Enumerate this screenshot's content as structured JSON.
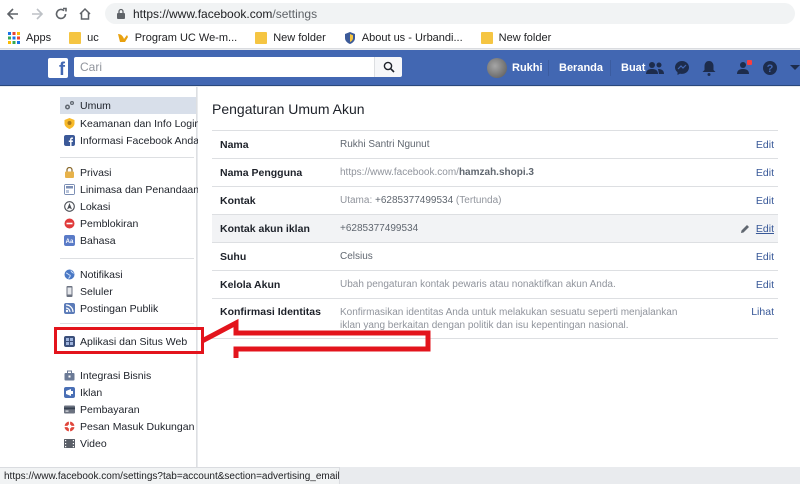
{
  "browser": {
    "url_host": "https://www.facebook.com",
    "url_path": "/settings",
    "bookmarks": [
      {
        "label": "Apps",
        "icon": "apps-grid-icon"
      },
      {
        "label": "uc",
        "icon": "folder-icon"
      },
      {
        "label": "Program UC We-m...",
        "icon": "uc-icon"
      },
      {
        "label": "New folder",
        "icon": "folder-icon"
      },
      {
        "label": "About us - Urbandi...",
        "icon": "shield-icon"
      },
      {
        "label": "New folder",
        "icon": "folder-icon"
      }
    ],
    "status_url": "https://www.facebook.com/settings?tab=account&section=advertising_email"
  },
  "fb": {
    "search_placeholder": "Cari",
    "user_name": "Rukhi",
    "nav_home": "Beranda",
    "nav_create": "Buat",
    "brand_color": "#4267b2"
  },
  "sidebar": {
    "group1": [
      {
        "label": "Umum",
        "icon": "gear-icon",
        "color": "#8d949e",
        "active": true
      },
      {
        "label": "Keamanan dan Info Login",
        "icon": "badge-icon",
        "color": "#f7b928"
      },
      {
        "label": "Informasi Facebook Anda",
        "icon": "facebook-icon",
        "color": "#3b5998"
      }
    ],
    "group2": [
      {
        "label": "Privasi",
        "icon": "lock-icon",
        "color": "#e7b24a"
      },
      {
        "label": "Linimasa dan Penandaan",
        "icon": "timeline-icon",
        "color": "#7c8fb5"
      },
      {
        "label": "Lokasi",
        "icon": "location-icon",
        "color": "#4b4f56"
      },
      {
        "label": "Pemblokiran",
        "icon": "block-icon",
        "color": "#e03b3b"
      },
      {
        "label": "Bahasa",
        "icon": "language-icon",
        "color": "#5a7bc7"
      }
    ],
    "group3": [
      {
        "label": "Notifikasi",
        "icon": "globe-icon",
        "color": "#4a78c4"
      },
      {
        "label": "Seluler",
        "icon": "mobile-icon",
        "color": "#6b7280"
      },
      {
        "label": "Postingan Publik",
        "icon": "rss-icon",
        "color": "#5b7bb8"
      }
    ],
    "group4": [
      {
        "label": "Aplikasi dan Situs Web",
        "icon": "apps-icon",
        "color": "#3b4f7a"
      },
      {
        "label": "Integrasi Bisnis",
        "icon": "business-icon",
        "color": "#6b7a96"
      },
      {
        "label": "Iklan",
        "icon": "ads-icon",
        "color": "#4a6fb5"
      },
      {
        "label": "Pembayaran",
        "icon": "payment-icon",
        "color": "#6b7280"
      },
      {
        "label": "Pesan Masuk Dukungan",
        "icon": "support-icon",
        "color": "#e0473c"
      },
      {
        "label": "Video",
        "icon": "video-icon",
        "color": "#5a5f68"
      }
    ]
  },
  "main": {
    "title": "Pengaturan Umum Akun",
    "rows": [
      {
        "key": "Nama",
        "value": "Rukhi Santri Ngunut",
        "action": "Edit"
      },
      {
        "key": "Nama Pengguna",
        "value_prefix": "https://www.facebook.com/",
        "value_bold": "hamzah.shopi.3",
        "action": "Edit"
      },
      {
        "key": "Kontak",
        "value_prefix": "Utama: ",
        "value_dark": "+6285377499534",
        "value_suffix": " (Tertunda)",
        "action": "Edit"
      },
      {
        "key": "Kontak akun iklan",
        "value": "+6285377499534",
        "action": "Edit"
      },
      {
        "key": "Suhu",
        "value": "Celsius",
        "action": "Edit"
      },
      {
        "key": "Kelola Akun",
        "value": "Ubah pengaturan kontak pewaris atau nonaktifkan akun Anda.",
        "action": "Edit"
      },
      {
        "key": "Konfirmasi Identitas",
        "value": "Konfirmasikan identitas Anda untuk melakukan sesuatu seperti menjalankan iklan yang berkaitan dengan politik dan isu kepentingan nasional.",
        "action": "Lihat"
      }
    ]
  },
  "annotation_color": "#e3141c"
}
